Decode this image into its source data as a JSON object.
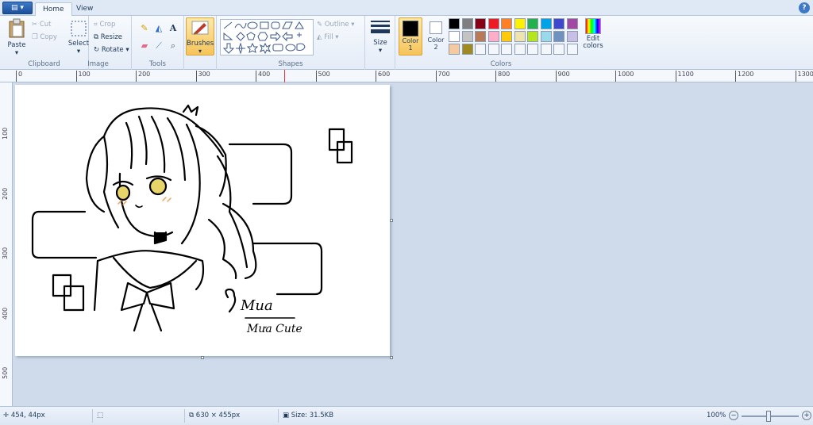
{
  "tabs": {
    "home": "Home",
    "view": "View"
  },
  "help_icon": "?",
  "clipboard": {
    "paste": "Paste",
    "cut": "Cut",
    "copy": "Copy",
    "label": "Clipboard"
  },
  "image": {
    "select": "Select",
    "crop": "Crop",
    "resize": "Resize",
    "rotate": "Rotate",
    "label": "Image"
  },
  "tools": {
    "label": "Tools",
    "brushes": "Brushes"
  },
  "shapes": {
    "outline": "Outline",
    "fill": "Fill",
    "label": "Shapes"
  },
  "size": {
    "label": "Size"
  },
  "colors": {
    "color1_label": "Color 1",
    "color2_label": "Color 2",
    "edit_colors": "Edit colors",
    "label": "Colors",
    "color1": "#000000",
    "color2": "#ffffff",
    "palette_row1": [
      "#000000",
      "#7f7f7f",
      "#880015",
      "#ed1c24",
      "#ff7f27",
      "#fff200",
      "#22b14c",
      "#00a2e8",
      "#3f48cc",
      "#a349a4"
    ],
    "palette_row2": [
      "#ffffff",
      "#c3c3c3",
      "#b97a57",
      "#ffaec9",
      "#ffc90e",
      "#efe4b0",
      "#b5e61d",
      "#99d9ea",
      "#7092be",
      "#c8bfe7"
    ],
    "palette_row3": [
      "#f7c9a0",
      "#a08a20",
      "",
      "",
      "",
      "",
      "",
      "",
      "",
      ""
    ]
  },
  "ruler": {
    "h_labels": [
      "0",
      "100",
      "200",
      "300",
      "400",
      "500",
      "600",
      "700",
      "800",
      "900",
      "1000",
      "1100",
      "1200",
      "1300"
    ],
    "v_labels": [
      "100",
      "200",
      "300",
      "400",
      "500"
    ]
  },
  "canvas_text": {
    "signature": "Mua",
    "subtitle": "Mưa Cute"
  },
  "status": {
    "cursor": "454, 44px",
    "dimensions": "630 × 455px",
    "size": "Size: 31.5KB",
    "zoom": "100%"
  }
}
